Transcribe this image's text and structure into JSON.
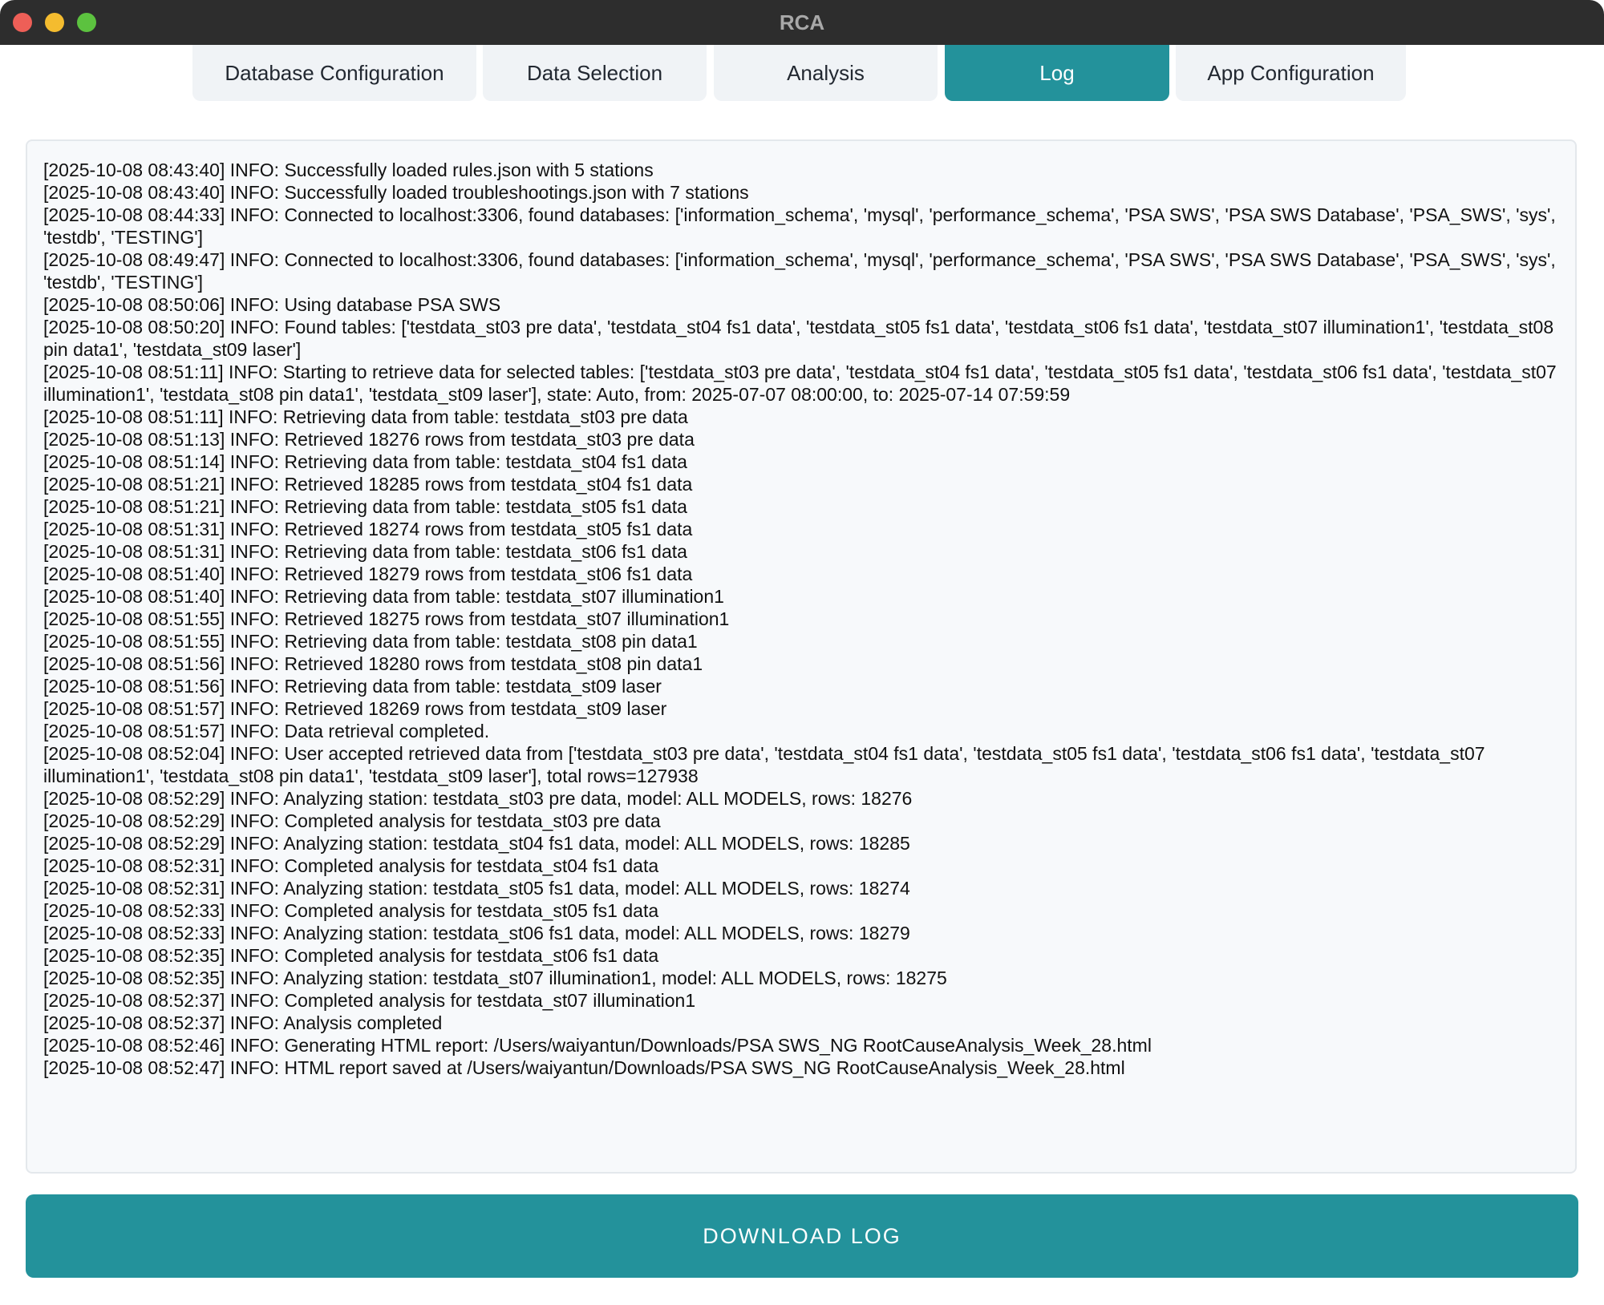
{
  "window": {
    "title": "RCA"
  },
  "tabs": [
    {
      "label": "Database Configuration"
    },
    {
      "label": "Data Selection"
    },
    {
      "label": "Analysis"
    },
    {
      "label": "Log",
      "active": true
    },
    {
      "label": "App Configuration"
    }
  ],
  "log": {
    "lines": [
      "[2025-10-08 08:43:40] INFO: Successfully loaded rules.json with 5 stations",
      "[2025-10-08 08:43:40] INFO: Successfully loaded troubleshootings.json with 7 stations",
      "[2025-10-08 08:44:33] INFO: Connected to localhost:3306, found databases: ['information_schema', 'mysql', 'performance_schema', 'PSA SWS', 'PSA SWS Database', 'PSA_SWS', 'sys', 'testdb', 'TESTING']",
      "[2025-10-08 08:49:47] INFO: Connected to localhost:3306, found databases: ['information_schema', 'mysql', 'performance_schema', 'PSA SWS', 'PSA SWS Database', 'PSA_SWS', 'sys', 'testdb', 'TESTING']",
      "[2025-10-08 08:50:06] INFO: Using database PSA SWS",
      "[2025-10-08 08:50:20] INFO: Found tables: ['testdata_st03 pre data', 'testdata_st04 fs1 data', 'testdata_st05 fs1 data', 'testdata_st06 fs1 data', 'testdata_st07 illumination1', 'testdata_st08 pin data1', 'testdata_st09 laser']",
      "[2025-10-08 08:51:11] INFO: Starting to retrieve data for selected tables: ['testdata_st03 pre data', 'testdata_st04 fs1 data', 'testdata_st05 fs1 data', 'testdata_st06 fs1 data', 'testdata_st07 illumination1', 'testdata_st08 pin data1', 'testdata_st09 laser'], state: Auto, from: 2025-07-07 08:00:00, to: 2025-07-14 07:59:59",
      "[2025-10-08 08:51:11] INFO: Retrieving data from table: testdata_st03 pre data",
      "[2025-10-08 08:51:13] INFO: Retrieved 18276 rows from testdata_st03 pre data",
      "[2025-10-08 08:51:14] INFO: Retrieving data from table: testdata_st04 fs1 data",
      "[2025-10-08 08:51:21] INFO: Retrieved 18285 rows from testdata_st04 fs1 data",
      "[2025-10-08 08:51:21] INFO: Retrieving data from table: testdata_st05 fs1 data",
      "[2025-10-08 08:51:31] INFO: Retrieved 18274 rows from testdata_st05 fs1 data",
      "[2025-10-08 08:51:31] INFO: Retrieving data from table: testdata_st06 fs1 data",
      "[2025-10-08 08:51:40] INFO: Retrieved 18279 rows from testdata_st06 fs1 data",
      "[2025-10-08 08:51:40] INFO: Retrieving data from table: testdata_st07 illumination1",
      "[2025-10-08 08:51:55] INFO: Retrieved 18275 rows from testdata_st07 illumination1",
      "[2025-10-08 08:51:55] INFO: Retrieving data from table: testdata_st08 pin data1",
      "[2025-10-08 08:51:56] INFO: Retrieved 18280 rows from testdata_st08 pin data1",
      "[2025-10-08 08:51:56] INFO: Retrieving data from table: testdata_st09 laser",
      "[2025-10-08 08:51:57] INFO: Retrieved 18269 rows from testdata_st09 laser",
      "[2025-10-08 08:51:57] INFO: Data retrieval completed.",
      "[2025-10-08 08:52:04] INFO: User accepted retrieved data from ['testdata_st03 pre data', 'testdata_st04 fs1 data', 'testdata_st05 fs1 data', 'testdata_st06 fs1 data', 'testdata_st07 illumination1', 'testdata_st08 pin data1', 'testdata_st09 laser'], total rows=127938",
      "[2025-10-08 08:52:29] INFO: Analyzing station: testdata_st03 pre data, model: ALL MODELS, rows: 18276",
      "[2025-10-08 08:52:29] INFO: Completed analysis for testdata_st03 pre data",
      "[2025-10-08 08:52:29] INFO: Analyzing station: testdata_st04 fs1 data, model: ALL MODELS, rows: 18285",
      "[2025-10-08 08:52:31] INFO: Completed analysis for testdata_st04 fs1 data",
      "[2025-10-08 08:52:31] INFO: Analyzing station: testdata_st05 fs1 data, model: ALL MODELS, rows: 18274",
      "[2025-10-08 08:52:33] INFO: Completed analysis for testdata_st05 fs1 data",
      "[2025-10-08 08:52:33] INFO: Analyzing station: testdata_st06 fs1 data, model: ALL MODELS, rows: 18279",
      "[2025-10-08 08:52:35] INFO: Completed analysis for testdata_st06 fs1 data",
      "[2025-10-08 08:52:35] INFO: Analyzing station: testdata_st07 illumination1, model: ALL MODELS, rows: 18275",
      "[2025-10-08 08:52:37] INFO: Completed analysis for testdata_st07 illumination1",
      "[2025-10-08 08:52:37] INFO: Analysis completed",
      "[2025-10-08 08:52:46] INFO: Generating HTML report: /Users/waiyantun/Downloads/PSA SWS_NG RootCauseAnalysis_Week_28.html",
      "[2025-10-08 08:52:47] INFO: HTML report saved at /Users/waiyantun/Downloads/PSA SWS_NG RootCauseAnalysis_Week_28.html"
    ]
  },
  "actions": {
    "download_label": "DOWNLOAD LOG"
  },
  "colors": {
    "accent": "#23929b",
    "titlebar": "#2d2d2d",
    "tab_inactive": "#f0f3f6",
    "log_bg": "#f7f9fb"
  }
}
